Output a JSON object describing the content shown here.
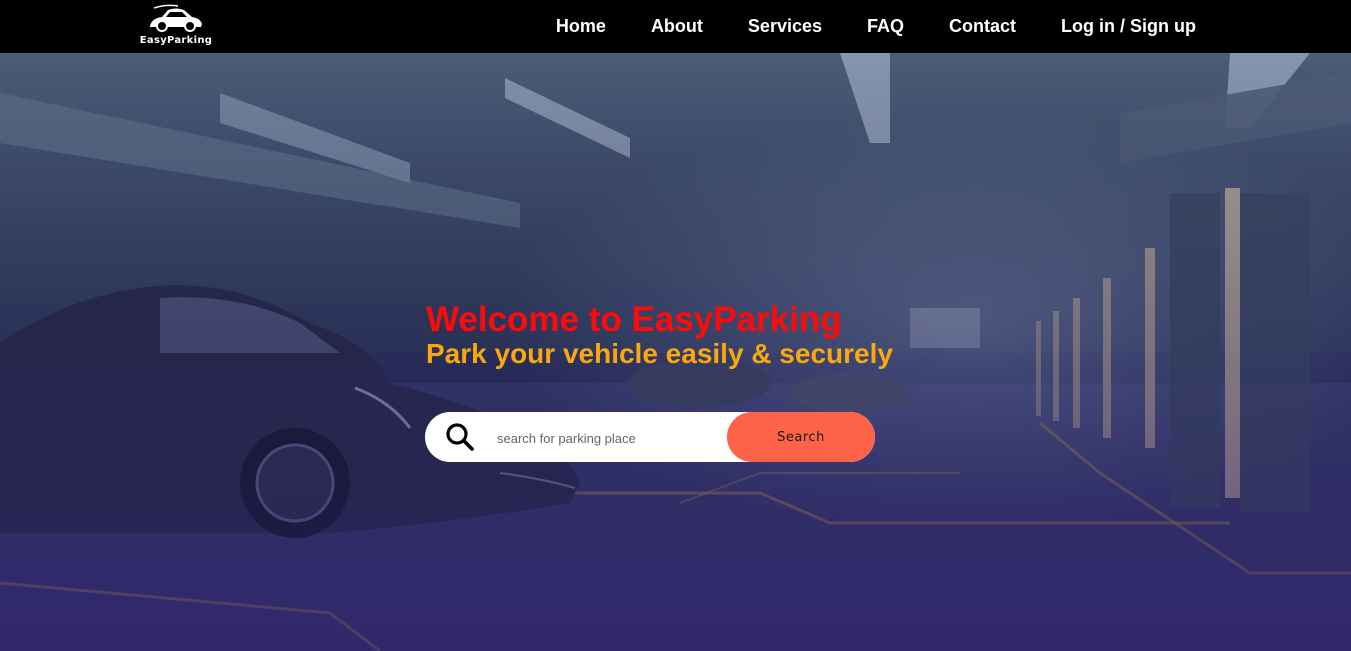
{
  "brand": {
    "name": "EasyParking"
  },
  "nav": {
    "items": [
      {
        "label": "Home"
      },
      {
        "label": "About"
      },
      {
        "label": "Services"
      },
      {
        "label": "FAQ"
      },
      {
        "label": "Contact"
      },
      {
        "label": "Log in / Sign up"
      }
    ]
  },
  "hero": {
    "title": "Welcome to EasyParking",
    "subtitle": "Park your vehicle easily & securely",
    "background_icon": "parking-garage-image"
  },
  "search": {
    "icon": "search-icon",
    "placeholder": "search for parking place",
    "value": "",
    "button_label": "Search"
  },
  "colors": {
    "navbar_bg": "#000000",
    "title": "#ff0a0a",
    "subtitle": "#f9a80e",
    "search_button": "#ff6347",
    "nav_text": "#ffffff"
  }
}
